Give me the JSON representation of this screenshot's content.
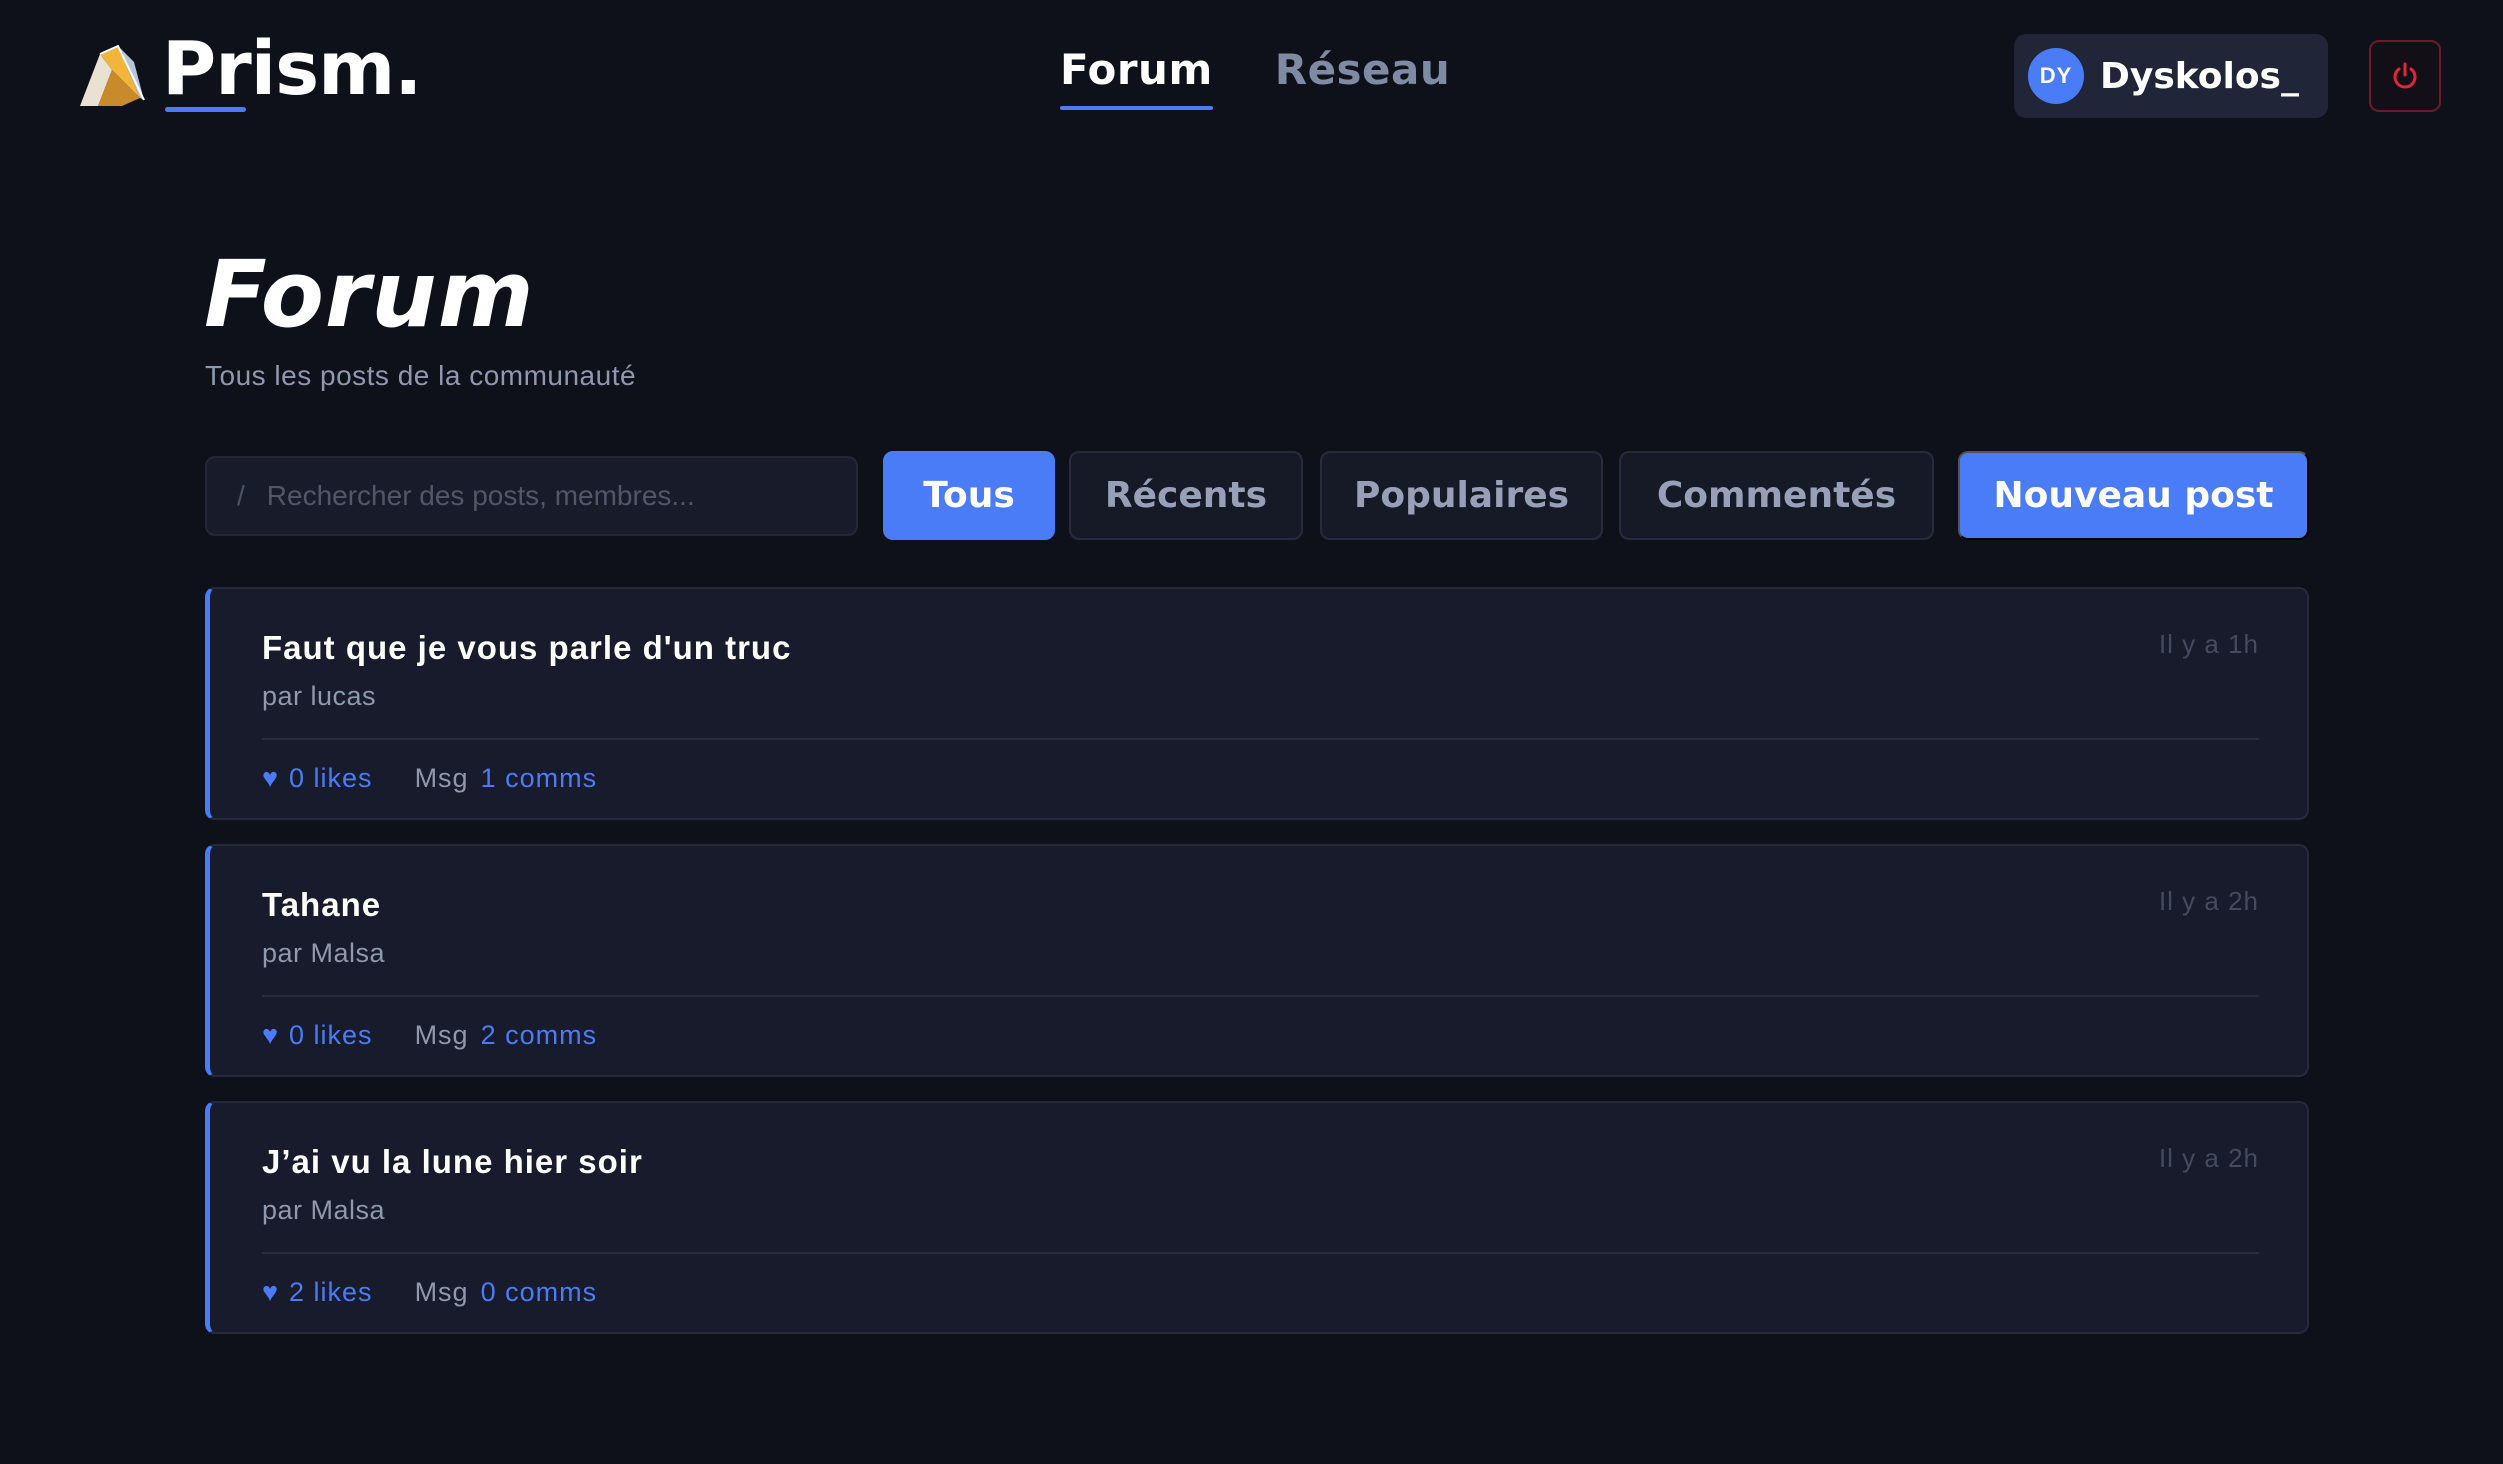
{
  "header": {
    "brand_name": "Prism",
    "brand_dot": ".",
    "nav": [
      {
        "label": "Forum",
        "active": true
      },
      {
        "label": "Réseau",
        "active": false
      }
    ],
    "user": {
      "initials": "DY",
      "name": "Dyskolos_"
    }
  },
  "page": {
    "title": "Forum",
    "subtitle": "Tous les posts de la communauté"
  },
  "toolbar": {
    "search_prefix": "/",
    "search_placeholder": "Rechercher des posts, membres...",
    "filters": [
      {
        "label": "Tous",
        "active": true
      },
      {
        "label": "Récents",
        "active": false
      },
      {
        "label": "Populaires",
        "active": false
      },
      {
        "label": "Commentés",
        "active": false
      }
    ],
    "new_post_label": "Nouveau post"
  },
  "posts": [
    {
      "title": "Faut que je vous parle d'un truc",
      "author": "par lucas",
      "time": "Il y a 1h",
      "likes": "0 likes",
      "msg_label": "Msg",
      "comments": "1 comms"
    },
    {
      "title": "Tahane",
      "author": "par Malsa",
      "time": "Il y a 2h",
      "likes": "0 likes",
      "msg_label": "Msg",
      "comments": "2 comms"
    },
    {
      "title": "J’ai vu la lune hier soir",
      "author": "par Malsa",
      "time": "Il y a 2h",
      "likes": "2 likes",
      "msg_label": "Msg",
      "comments": "0 comms"
    }
  ],
  "icons": {
    "heart": "♥",
    "logout": "power-icon",
    "logo": "prism-logo-icon"
  },
  "colors": {
    "accent": "#4a7cf7",
    "background": "#0e111a",
    "card": "#171b2b",
    "logout_red": "#e0263a"
  }
}
